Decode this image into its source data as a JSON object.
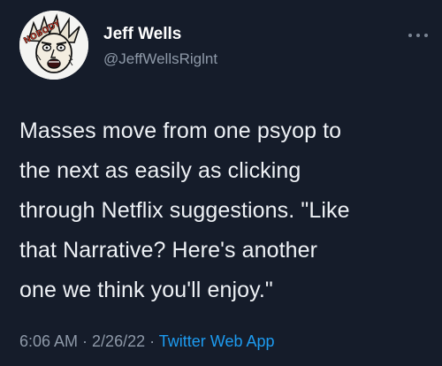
{
  "author": {
    "display_name": "Jeff Wells",
    "handle": "@JeffWellsRiglnt",
    "avatar_icon": "comic-face-avatar",
    "avatar_text": "NOBODY"
  },
  "more_icon": "more-horizontal-icon",
  "tweet": {
    "lines": [
      "Masses move from one psyop to",
      "the next as easily as clicking",
      "through Netflix suggestions. \"Like",
      "that Narrative? Here's another",
      "one we think you'll enjoy.\""
    ]
  },
  "meta": {
    "time": "6:06 AM",
    "separator": " · ",
    "date": "2/26/22",
    "source": "Twitter Web App"
  },
  "colors": {
    "background": "#151c2a",
    "text": "#eef1f5",
    "secondary": "#8e99a8",
    "accent": "#1d9bf0"
  }
}
